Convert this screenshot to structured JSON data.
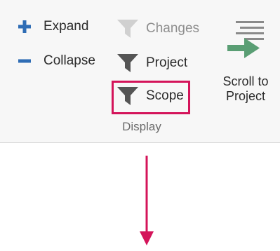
{
  "ribbon": {
    "expand_label": "Expand",
    "collapse_label": "Collapse",
    "changes_label": "Changes",
    "project_label": "Project",
    "scope_label": "Scope",
    "group_label": "Display",
    "scroll_label_line1": "Scroll to",
    "scroll_label_line2": "Project"
  },
  "icons": {
    "expand": "plus-icon",
    "collapse": "minus-icon",
    "changes": "funnel-icon",
    "project": "funnel-icon",
    "scope": "funnel-icon",
    "scroll_to_project": "arrow-right-lines-icon"
  },
  "colors": {
    "accent_blue": "#2f6db5",
    "highlight": "#d4145a",
    "arrow_green": "#5a9e74",
    "annotation_arrow": "#d4145a"
  },
  "state": {
    "changes_enabled": false,
    "highlighted": "scope"
  }
}
